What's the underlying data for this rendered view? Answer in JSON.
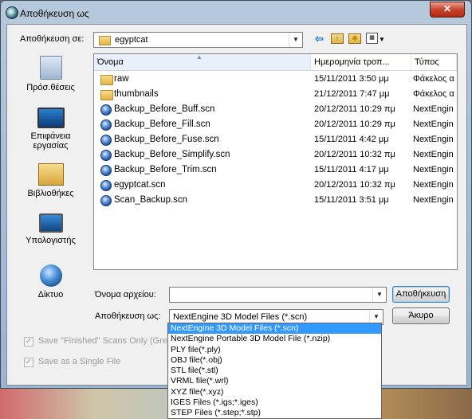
{
  "window": {
    "title": "Αποθήκευση ως",
    "close_glyph": "✕"
  },
  "save_in": {
    "label": "Αποθήκευση σε:",
    "value": "egyptcat"
  },
  "toolbar": {
    "icons": [
      "back-arrow-icon",
      "up-folder-icon",
      "new-folder-icon",
      "view-menu-icon"
    ]
  },
  "places": [
    {
      "label": "Πρόσ.θέσεις",
      "icon": "recent-places-icon"
    },
    {
      "label": "Επιφάνεια εργασίας",
      "icon": "desktop-icon"
    },
    {
      "label": "Βιβλιοθήκες",
      "icon": "libraries-icon"
    },
    {
      "label": "Υπολογιστής",
      "icon": "computer-icon"
    },
    {
      "label": "Δίκτυο",
      "icon": "network-icon"
    }
  ],
  "columns": [
    "Όνομα",
    "Ημερομηνία τροπ...",
    "Τύπος"
  ],
  "files": [
    {
      "name": "raw",
      "date": "15/11/2011 3:50 μμ",
      "type": "Φάκελος α",
      "kind": "folder"
    },
    {
      "name": "thumbnails",
      "date": "21/12/2011 7:47 μμ",
      "type": "Φάκελος α",
      "kind": "folder"
    },
    {
      "name": "Backup_Before_Buff.scn",
      "date": "20/12/2011 10:29 πμ",
      "type": "NextEngin",
      "kind": "scn"
    },
    {
      "name": "Backup_Before_Fill.scn",
      "date": "20/12/2011 10:29 πμ",
      "type": "NextEngin",
      "kind": "scn"
    },
    {
      "name": "Backup_Before_Fuse.scn",
      "date": "15/11/2011 4:42 μμ",
      "type": "NextEngin",
      "kind": "scn"
    },
    {
      "name": "Backup_Before_Simplify.scn",
      "date": "20/12/2011 10:32 πμ",
      "type": "NextEngin",
      "kind": "scn"
    },
    {
      "name": "Backup_Before_Trim.scn",
      "date": "15/11/2011 4:17 μμ",
      "type": "NextEngin",
      "kind": "scn"
    },
    {
      "name": "egyptcat.scn",
      "date": "20/12/2011 10:32 πμ",
      "type": "NextEngin",
      "kind": "scn"
    },
    {
      "name": "Scan_Backup.scn",
      "date": "15/11/2011 3:51 μμ",
      "type": "NextEngin",
      "kind": "scn"
    }
  ],
  "filename": {
    "label": "Όνομα αρχείου:",
    "value": ""
  },
  "save_as": {
    "label": "Αποθήκευση ως:",
    "value": "NextEngine 3D Model Files (*.scn)"
  },
  "buttons": {
    "save": "Αποθήκευση",
    "cancel": "Άκυρο"
  },
  "filetype_options": [
    "NextEngine 3D Model Files (*.scn)",
    "NextEngine Portable 3D Model File (*.nzip)",
    "PLY file(*.ply)",
    "OBJ file(*.obj)",
    "STL file(*.stl)",
    "VRML file(*.wrl)",
    "XYZ file(*.xyz)",
    "IGES Files (*.igs;*.iges)",
    "STEP Files (*.step;*.stp)"
  ],
  "options": {
    "save_finished": "Save \"Finished\" Scans Only (Gree",
    "single_file": "Save as a Single File"
  }
}
